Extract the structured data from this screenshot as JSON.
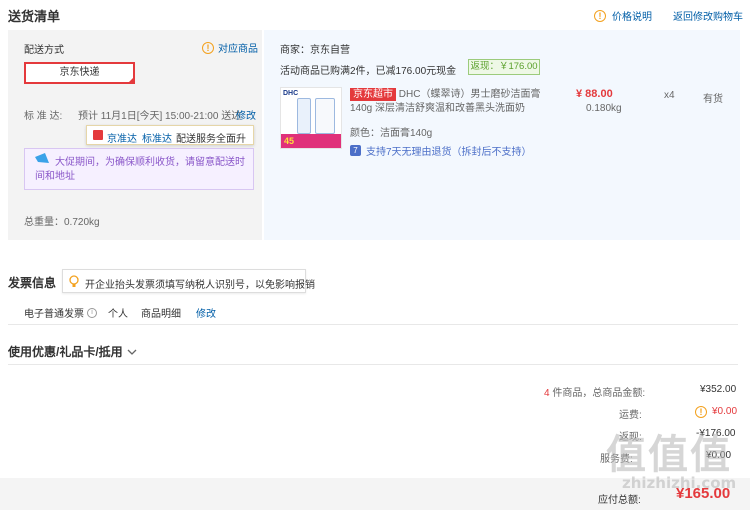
{
  "header": {
    "title": "送货清单",
    "price_info_label": "价格说明",
    "back_to_cart_label": "返回修改购物车"
  },
  "shipping": {
    "method_label": "配送方式",
    "eligible_goods_label": "对应商品",
    "selected_method": "京东快递",
    "standard_label": "标 准 达:",
    "standard_value": "预计 11月1日[今天] 15:00-21:00 送达",
    "modify_label": "修改",
    "tooltip_brand": "京准达",
    "tooltip_service": "标准达",
    "tooltip_text": "配送服务全面升级",
    "promo_notice": "大促期间，为确保顺利收货，请留意配送时间和地址",
    "total_weight_label": "总重量：",
    "total_weight_value": "0.720kg"
  },
  "order": {
    "merchant_label": "商家：京东自营",
    "promo_text": "活动商品已购满2件，已减176.00元现金",
    "rebate_label": "返现：￥176.00",
    "item": {
      "badge": "京东超市",
      "name": "DHC（蝶翠诗）男士磨砂洁面膏140g 深层清洁舒爽温和改善黑头洗面奶",
      "price": "¥ 88.00",
      "weight": "0.180kg",
      "quantity": "x4",
      "stock": "有货",
      "color_label": "颜色：洁面膏140g",
      "return_policy": "支持7天无理由退货（拆封后不支持）",
      "img_brand": "DHC",
      "img_badge": "45"
    }
  },
  "invoice": {
    "title": "发票信息",
    "tip": "开企业抬头发票须填写纳税人识别号，以免影响报销",
    "type": "电子普通发票",
    "holder": "个人",
    "content": "商品明细",
    "modify_label": "修改"
  },
  "coupons": {
    "title": "使用优惠/礼品卡/抵用"
  },
  "summary": {
    "count_num": "4",
    "count_text": " 件商品，总商品金额:",
    "total_amount": "¥352.00",
    "shipping_label": "运费:",
    "shipping_value": "¥0.00",
    "rebate_label": "返现:",
    "rebate_value": "-¥176.00",
    "service_label": "服务费:",
    "service_value": "¥0.00",
    "payable_label": "应付总额:",
    "payable_value": "¥165.00"
  },
  "watermark": {
    "logo": "值值值",
    "domain": "zhizhizhi.com"
  },
  "colors": {
    "accent_red": "#e4393c",
    "link_blue": "#005ea7",
    "warning_orange": "#f3a11e",
    "rebate_green": "#5aa02c"
  }
}
